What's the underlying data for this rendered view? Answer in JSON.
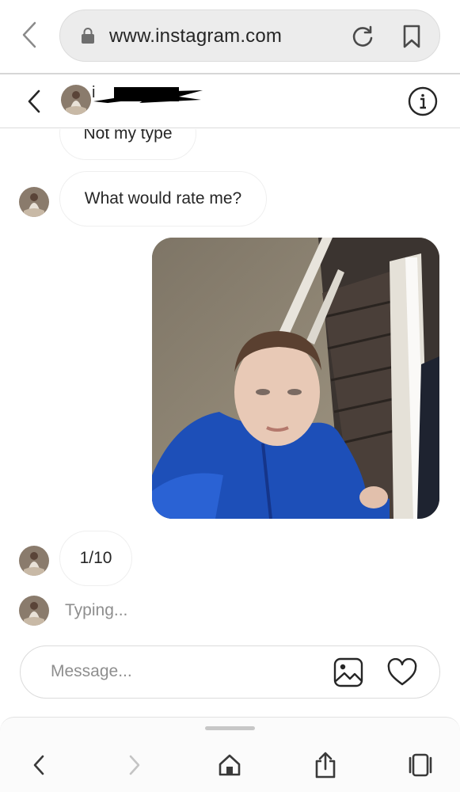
{
  "browser": {
    "url": "www.instagram.com",
    "icons": {
      "back": "chevron-left-icon",
      "lock": "lock-icon",
      "reload": "reload-icon",
      "bookmark": "bookmark-icon"
    }
  },
  "chat_header": {
    "username_visible": "i",
    "icons": {
      "back": "chevron-left-icon",
      "info": "info-icon"
    }
  },
  "messages": [
    {
      "type": "text",
      "direction": "incoming",
      "text": "Not my type"
    },
    {
      "type": "text",
      "direction": "incoming",
      "text": "What would rate me?"
    },
    {
      "type": "photo",
      "direction": "outgoing",
      "description_icon": "photo-message"
    },
    {
      "type": "text",
      "direction": "incoming",
      "text": "1/10"
    }
  ],
  "typing_indicator": "Typing...",
  "composer": {
    "placeholder": "Message...",
    "icons": {
      "image": "image-icon",
      "like": "heart-icon"
    }
  },
  "toolbar": {
    "icons": [
      "back-icon",
      "forward-icon",
      "home-icon",
      "share-icon",
      "tabs-icon"
    ]
  },
  "colors": {
    "background": "#ffffff",
    "text": "#262626",
    "secondary_text": "#8e8e8e",
    "bubble_border": "#efefef",
    "url_bar": "#ececec"
  }
}
